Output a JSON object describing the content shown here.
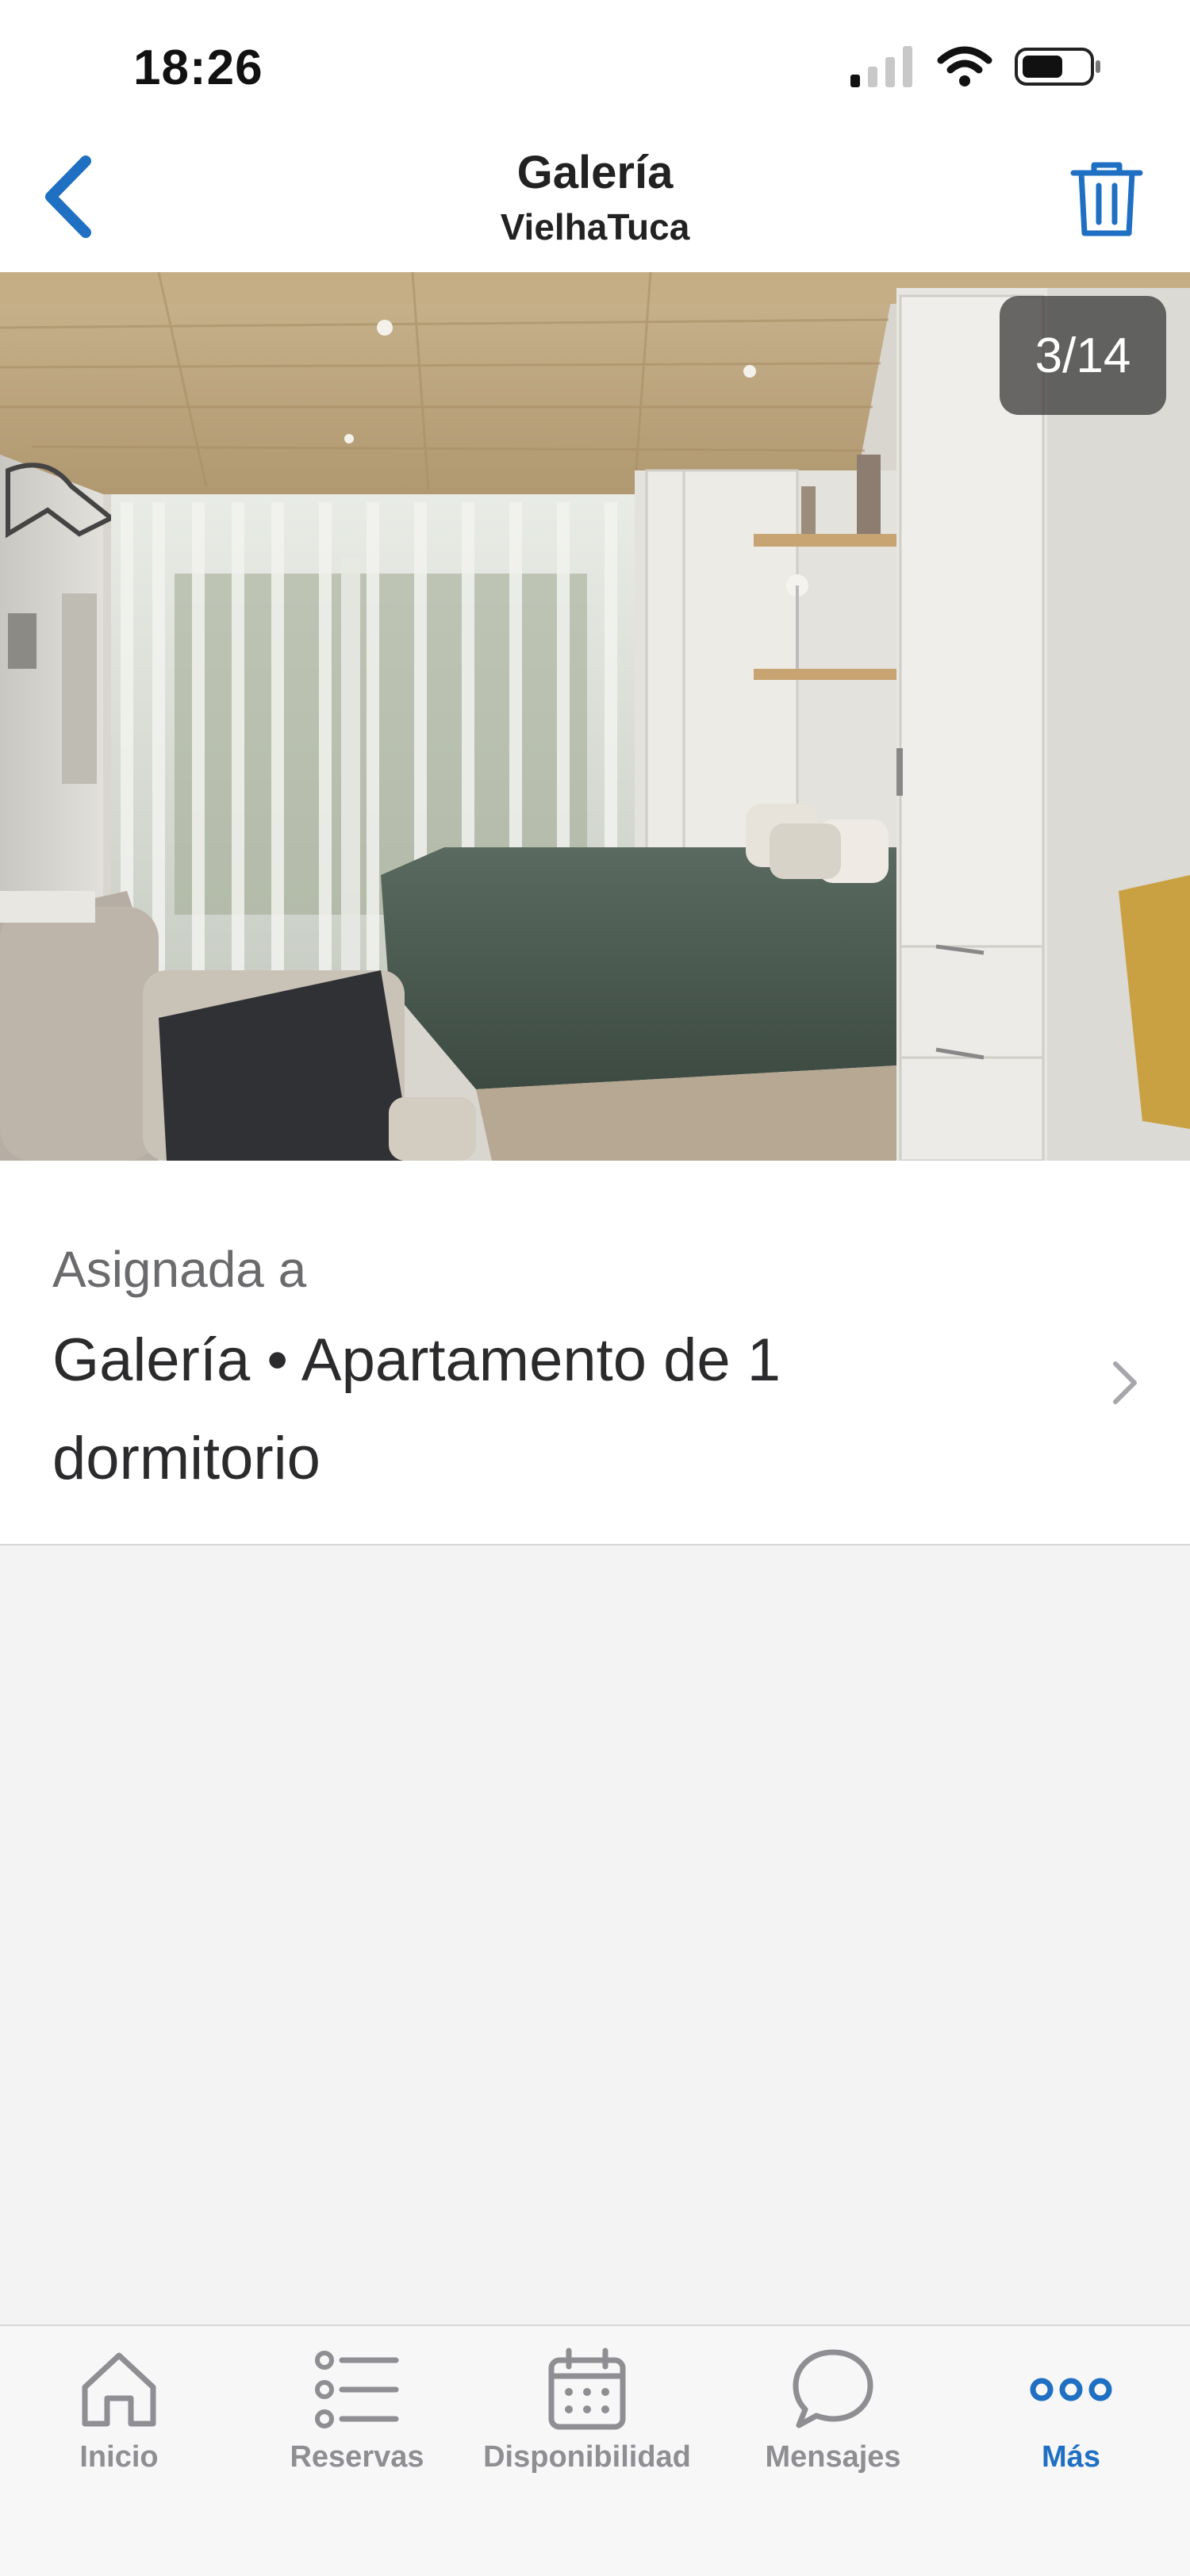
{
  "status_bar": {
    "time": "18:26",
    "icons": [
      "cellular-signal-icon",
      "wifi-icon",
      "battery-icon"
    ]
  },
  "header": {
    "title": "Galería",
    "subtitle": "VielhaTuca",
    "back_icon": "chevron-left-icon",
    "delete_icon": "trash-icon"
  },
  "photo": {
    "counter": "3/14",
    "current": 3,
    "total": 14
  },
  "assignment": {
    "label": "Asignada a",
    "value": "Galería • Apartamento de 1 dormitorio"
  },
  "tab_bar": {
    "tabs": [
      {
        "label": "Inicio",
        "icon": "home-icon",
        "active": false
      },
      {
        "label": "Reservas",
        "icon": "list-icon",
        "active": false
      },
      {
        "label": "Disponibilidad",
        "icon": "calendar-icon",
        "active": false
      },
      {
        "label": "Mensajes",
        "icon": "chat-bubble-icon",
        "active": false
      },
      {
        "label": "Más",
        "icon": "more-dots-icon",
        "active": true
      }
    ]
  },
  "colors": {
    "accent": "#1f6fc2",
    "inactive": "#8e8e93",
    "background": "#f3f3f4"
  }
}
